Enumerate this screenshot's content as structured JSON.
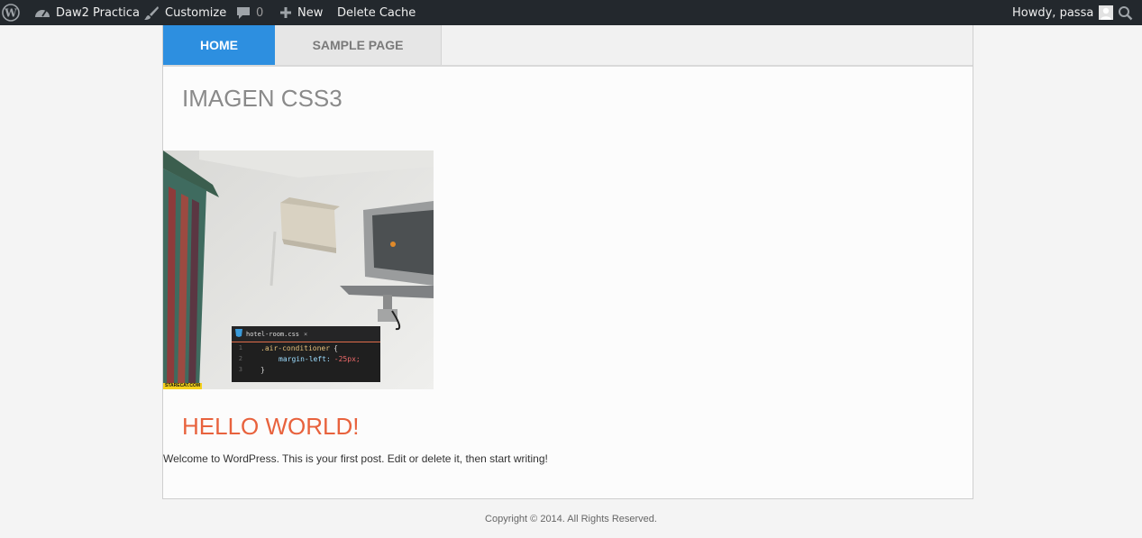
{
  "adminbar": {
    "site_name": "Daw2 Practica",
    "customize_label": "Customize",
    "comments_count": "0",
    "new_label": "New",
    "delete_cache_label": "Delete Cache",
    "howdy_text": "Howdy, passa",
    "icons": {
      "wp": "wordpress-logo-icon",
      "site": "dashboard-icon",
      "customize": "brush-icon",
      "comments": "comment-bubble-icon",
      "new": "plus-icon",
      "avatar": "user-avatar-icon",
      "search": "search-icon"
    }
  },
  "nav": {
    "items": [
      {
        "label": "Home",
        "active": true
      },
      {
        "label": "Sample Page",
        "active": false
      }
    ],
    "active_color": "#2d8fe0"
  },
  "posts": [
    {
      "title": "IMAGEN CSS3",
      "image": {
        "code_tab": "hotel-room.css",
        "code_close": "×",
        "code_lines": [
          {
            "num": "1",
            "selector": ".air-conditioner",
            "brace": "{"
          },
          {
            "num": "2",
            "property": "margin-left:",
            "value": "-25px;"
          },
          {
            "num": "3",
            "close": "}"
          }
        ],
        "watermark": "STARECAT.COM"
      }
    },
    {
      "title": "HELLO WORLD!",
      "title_color": "#e8623d",
      "excerpt": "Welcome to WordPress. This is your first post. Edit or delete it, then start writing!"
    }
  ],
  "footer": {
    "copyright": "Copyright © 2014. All Rights Reserved."
  }
}
